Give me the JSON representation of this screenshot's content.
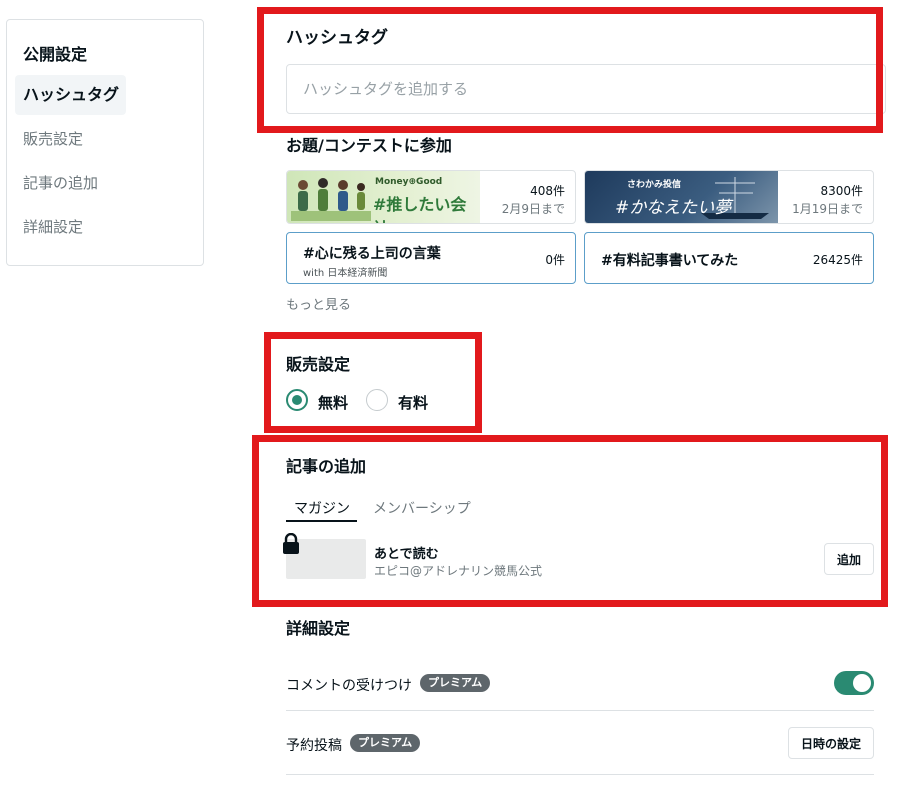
{
  "sidebar": {
    "title": "公開設定",
    "items": [
      {
        "label": "ハッシュタグ",
        "active": true
      },
      {
        "label": "販売設定",
        "active": false
      },
      {
        "label": "記事の追加",
        "active": false
      },
      {
        "label": "詳細設定",
        "active": false
      }
    ]
  },
  "hashtag": {
    "title": "ハッシュタグ",
    "placeholder": "ハッシュタグを追加する"
  },
  "contests": {
    "title": "お題/コンテストに参加",
    "cards": [
      {
        "banner_brand": "Money⊕Good",
        "banner_text": "#推したい会社",
        "count": "408件",
        "deadline": "2月9日まで"
      },
      {
        "banner_brand": "さわかみ投信",
        "banner_text": "#かなえたい夢",
        "count": "8300件",
        "deadline": "1月19日まで"
      },
      {
        "title": "#心に残る上司の言葉",
        "subtitle": "with 日本経済新聞",
        "count": "0件"
      },
      {
        "title": "#有料記事書いてみた",
        "count": "26425件"
      }
    ],
    "more_label": "もっと見る"
  },
  "sales": {
    "title": "販売設定",
    "options": [
      {
        "label": "無料",
        "checked": true
      },
      {
        "label": "有料",
        "checked": false
      }
    ]
  },
  "add_article": {
    "title": "記事の追加",
    "tabs": [
      {
        "label": "マガジン",
        "active": true
      },
      {
        "label": "メンバーシップ",
        "active": false
      }
    ],
    "magazine": {
      "name": "あとで読む",
      "author": "エピコ@アドレナリン競馬公式",
      "button": "追加"
    }
  },
  "details": {
    "title": "詳細設定",
    "rows": [
      {
        "label": "コメントの受けつけ",
        "badge": "プレミアム",
        "toggle_on": true
      },
      {
        "label": "予約投稿",
        "badge": "プレミアム",
        "button": "日時の設定"
      }
    ]
  },
  "colors": {
    "accent": "#2a8a72",
    "highlight": "#e2191c"
  }
}
